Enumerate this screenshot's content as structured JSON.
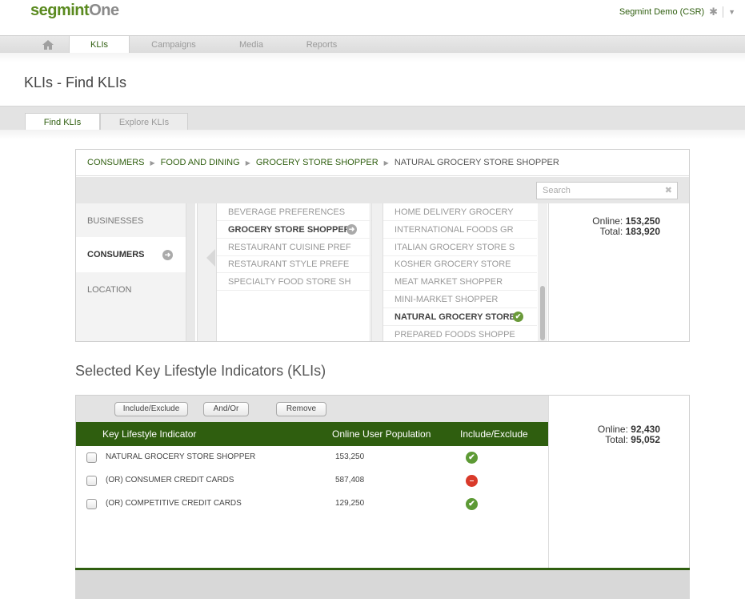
{
  "app": {
    "logo_segmint": "segmint",
    "logo_one": "One",
    "user": "Segmint Demo (CSR)",
    "user_menu_icon": "gear-icon",
    "dropdown_icon": "chevron-down-icon"
  },
  "nav": {
    "home_icon": "home-icon",
    "items": [
      "KLIs",
      "Campaigns",
      "Media",
      "Reports"
    ],
    "active": "KLIs"
  },
  "page_title": "KLIs - Find KLIs",
  "subtabs": [
    "Find KLIs",
    "Explore KLIs"
  ],
  "breadcrumb": [
    "CONSUMERS",
    "FOOD AND DINING",
    "GROCERY STORE SHOPPER",
    "NATURAL GROCERY STORE SHOPPER"
  ],
  "search": {
    "placeholder": "Search",
    "clear_icon": "close-icon"
  },
  "categories": [
    "BUSINESSES",
    "CONSUMERS",
    "LOCATION"
  ],
  "subcategories": [
    "BEVERAGE PREFERENCES",
    "GROCERY STORE SHOPPER",
    "RESTAURANT CUISINE PREF",
    "RESTAURANT STYLE PREFE",
    "SPECIALTY FOOD STORE SH"
  ],
  "klis": [
    "HOME DELIVERY GROCERY",
    "INTERNATIONAL FOODS GR",
    "ITALIAN GROCERY STORE S",
    "KOSHER GROCERY STORE",
    "MEAT MARKET SHOPPER",
    "MINI-MARKET SHOPPER",
    "NATURAL GROCERY STORE",
    "PREPARED FOODS SHOPPE"
  ],
  "browse_counts": {
    "online_label": "Online:",
    "online": "153,250",
    "total_label": "Total:",
    "total": "183,920"
  },
  "selected_title": "Selected Key Lifestyle Indicators (KLIs)",
  "toolbar": {
    "include_exclude": "Include/Exclude",
    "and_or": "And/Or",
    "remove": "Remove"
  },
  "table": {
    "headers": [
      "Key Lifestyle Indicator",
      "Online User Population",
      "Include/Exclude"
    ],
    "rows": [
      {
        "name": "NATURAL GROCERY STORE SHOPPER",
        "population": "153,250",
        "status": "include"
      },
      {
        "name": "(OR) CONSUMER CREDIT CARDS",
        "population": "587,408",
        "status": "exclude"
      },
      {
        "name": "(OR) COMPETITIVE CREDIT CARDS",
        "population": "129,250",
        "status": "include"
      }
    ]
  },
  "selected_counts": {
    "online_label": "Online:",
    "online": "92,430",
    "total_label": "Total:",
    "total": "95,052"
  },
  "colors": {
    "brand_green": "#2f5e0f",
    "include": "#5d9a35",
    "exclude": "#d93a2a"
  }
}
